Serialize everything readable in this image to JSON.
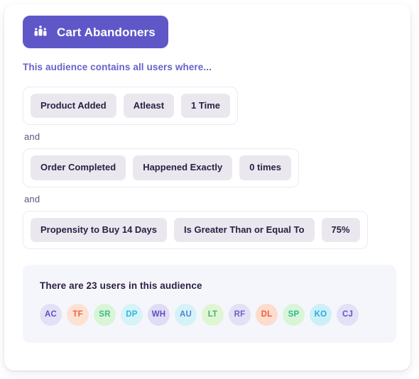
{
  "card": {
    "header": {
      "icon": "users-group-icon",
      "title": "Cart Abandoners",
      "accent_color": "#5f57c8"
    },
    "subtitle": "This audience contains all users where...",
    "connector_label": "and",
    "conditions": [
      {
        "event": "Product Added",
        "operator": "Atleast",
        "value": "1 Time"
      },
      {
        "event": "Order Completed",
        "operator": "Happened Exactly",
        "value": "0 times"
      },
      {
        "event": "Propensity to Buy 14 Days",
        "operator": "Is Greater Than or Equal To",
        "value": "75%"
      }
    ],
    "results": {
      "summary": "There are 23 users in this audience",
      "user_count": 23,
      "avatars": [
        {
          "initials": "AC",
          "bg": "#e4e0f6",
          "fg": "#5a51c4"
        },
        {
          "initials": "TF",
          "bg": "#fde2d4",
          "fg": "#f2663c"
        },
        {
          "initials": "SR",
          "bg": "#d9f5d8",
          "fg": "#3fba86"
        },
        {
          "initials": "DP",
          "bg": "#d6f3f8",
          "fg": "#2bb8e0"
        },
        {
          "initials": "WH",
          "bg": "#e0dcf5",
          "fg": "#5a51c4"
        },
        {
          "initials": "AU",
          "bg": "#d5f2f7",
          "fg": "#4a86d8"
        },
        {
          "initials": "LT",
          "bg": "#e0f6d3",
          "fg": "#49b07a"
        },
        {
          "initials": "RF",
          "bg": "#e4e0f6",
          "fg": "#6a62c9"
        },
        {
          "initials": "DL",
          "bg": "#fddccd",
          "fg": "#ef5c38"
        },
        {
          "initials": "SP",
          "bg": "#d9f5d8",
          "fg": "#2fb98f"
        },
        {
          "initials": "KO",
          "bg": "#ccf0f7",
          "fg": "#2aa9dd"
        },
        {
          "initials": "CJ",
          "bg": "#e4e0f6",
          "fg": "#5f57c8"
        }
      ]
    }
  }
}
